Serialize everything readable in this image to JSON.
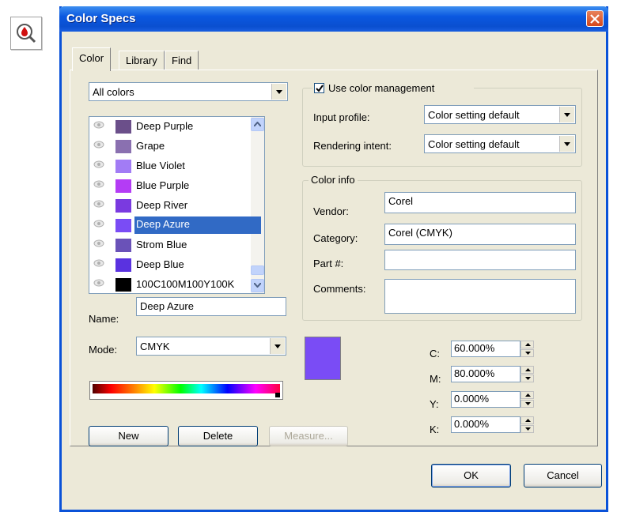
{
  "window": {
    "title": "Color Specs"
  },
  "tabs": [
    {
      "label": "Color",
      "active": true
    },
    {
      "label": "Library",
      "active": false
    },
    {
      "label": "Find",
      "active": false
    }
  ],
  "filter": {
    "selected": "All colors"
  },
  "colors": [
    {
      "name": "Deep Purple",
      "color": "#6b4f8a"
    },
    {
      "name": "Grape",
      "color": "#8a70b0"
    },
    {
      "name": "Blue Violet",
      "color": "#a27cf5"
    },
    {
      "name": "Blue Purple",
      "color": "#b43cf5"
    },
    {
      "name": "Deep River",
      "color": "#7a3ae0"
    },
    {
      "name": "Deep Azure",
      "color": "#7a4cf5",
      "selected": true
    },
    {
      "name": "Strom Blue",
      "color": "#6a52b8"
    },
    {
      "name": "Deep Blue",
      "color": "#5a32e0"
    },
    {
      "name": "100C100M100Y100K",
      "color": "#000000"
    }
  ],
  "name_field": {
    "label": "Name:",
    "value": "Deep Azure"
  },
  "mode": {
    "label": "Mode:",
    "value": "CMYK"
  },
  "buttons": {
    "new": "New",
    "delete": "Delete",
    "measure": "Measure...",
    "ok": "OK",
    "cancel": "Cancel"
  },
  "color_management": {
    "checkbox_label": "Use color management",
    "checked": true,
    "input_profile_label": "Input profile:",
    "input_profile_value": "Color setting default",
    "rendering_intent_label": "Rendering intent:",
    "rendering_intent_value": "Color setting default"
  },
  "color_info": {
    "title": "Color info",
    "vendor_label": "Vendor:",
    "vendor": "Corel",
    "category_label": "Category:",
    "category": "Corel (CMYK)",
    "part_label": "Part #:",
    "part": "",
    "comments_label": "Comments:",
    "comments": ""
  },
  "cmyk": {
    "c_label": "C:",
    "c": "60.000%",
    "m_label": "M:",
    "m": "80.000%",
    "y_label": "Y:",
    "y": "0.000%",
    "k_label": "K:",
    "k": "0.000%"
  },
  "preview_color": "#7a4cf5"
}
